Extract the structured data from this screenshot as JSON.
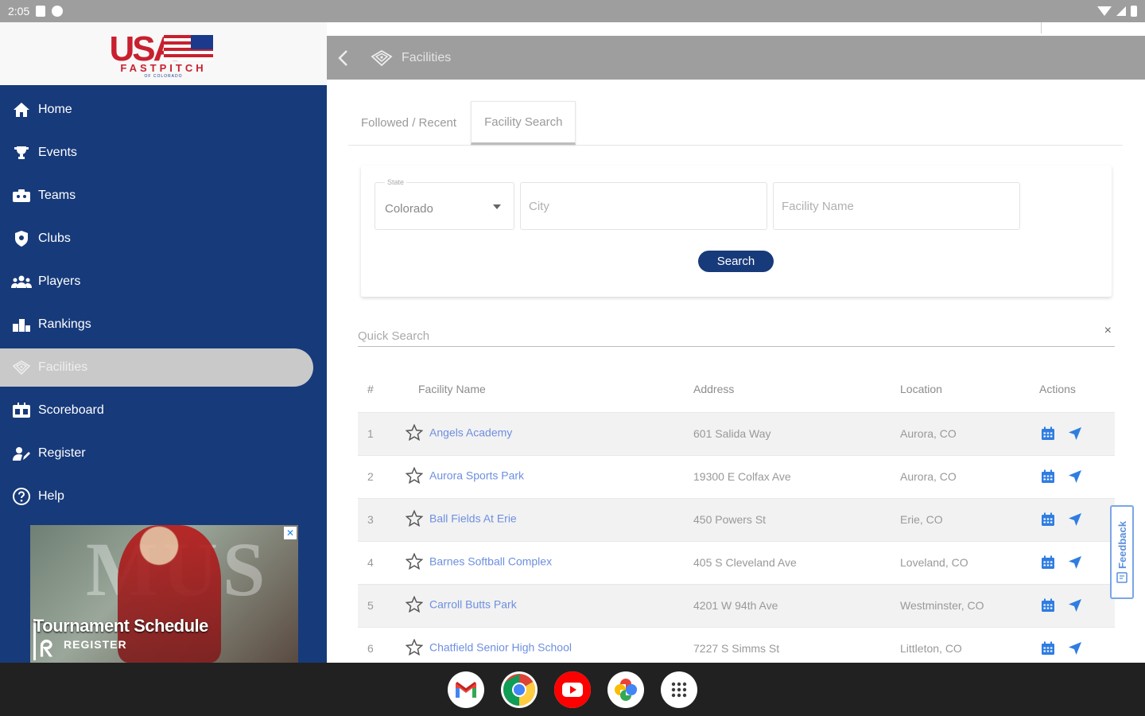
{
  "status_bar": {
    "time": "2:05"
  },
  "sidebar": {
    "logo": {
      "usa": "USA",
      "fastpitch": "FASTPITCH",
      "sub": "OF COLORADO"
    },
    "items": [
      {
        "label": "Home",
        "icon": "home-icon"
      },
      {
        "label": "Events",
        "icon": "trophy-icon"
      },
      {
        "label": "Teams",
        "icon": "teams-icon"
      },
      {
        "label": "Clubs",
        "icon": "shield-icon"
      },
      {
        "label": "Players",
        "icon": "players-icon"
      },
      {
        "label": "Rankings",
        "icon": "rankings-icon"
      },
      {
        "label": "Facilities",
        "icon": "diamond-icon",
        "active": true
      },
      {
        "label": "Scoreboard",
        "icon": "scoreboard-icon"
      },
      {
        "label": "Register",
        "icon": "register-icon"
      },
      {
        "label": "Help",
        "icon": "help-icon"
      }
    ],
    "ad": {
      "headline": "Tournament Schedule",
      "register": "REGISTER",
      "bg_letters": "MUS"
    }
  },
  "header": {
    "title": "Facilities"
  },
  "tabs": [
    {
      "label": "Followed / Recent",
      "active": false
    },
    {
      "label": "Facility Search",
      "active": true
    }
  ],
  "search": {
    "state_label": "State",
    "state_value": "Colorado",
    "city_placeholder": "City",
    "facility_placeholder": "Facility Name",
    "button_label": "Search"
  },
  "quick_search": {
    "placeholder": "Quick Search",
    "clear": "×"
  },
  "table": {
    "headers": {
      "num": "#",
      "name": "Facility Name",
      "address": "Address",
      "location": "Location",
      "actions": "Actions"
    },
    "rows": [
      {
        "num": "1",
        "name": "Angels Academy",
        "address": "601 Salida Way",
        "location": "Aurora, CO"
      },
      {
        "num": "2",
        "name": "Aurora Sports Park",
        "address": "19300 E Colfax Ave",
        "location": "Aurora, CO"
      },
      {
        "num": "3",
        "name": "Ball Fields At Erie",
        "address": "450 Powers St",
        "location": "Erie, CO"
      },
      {
        "num": "4",
        "name": "Barnes Softball Complex",
        "address": "405 S Cleveland Ave",
        "location": "Loveland, CO"
      },
      {
        "num": "5",
        "name": "Carroll Butts Park",
        "address": "4201 W 94th Ave",
        "location": "Westminster, CO"
      },
      {
        "num": "6",
        "name": "Chatfield Senior High School",
        "address": "7227 S Simms St",
        "location": "Littleton, CO"
      }
    ]
  },
  "feedback": {
    "label": "Feedback"
  },
  "dock": {
    "apps": [
      "gmail-icon",
      "chrome-icon",
      "youtube-icon",
      "photos-icon",
      "app-drawer-icon"
    ]
  },
  "colors": {
    "navy": "#173a7a",
    "link": "#6d8fe0",
    "action_blue": "#2f7de1",
    "app_bar": "#9e9e9e"
  }
}
